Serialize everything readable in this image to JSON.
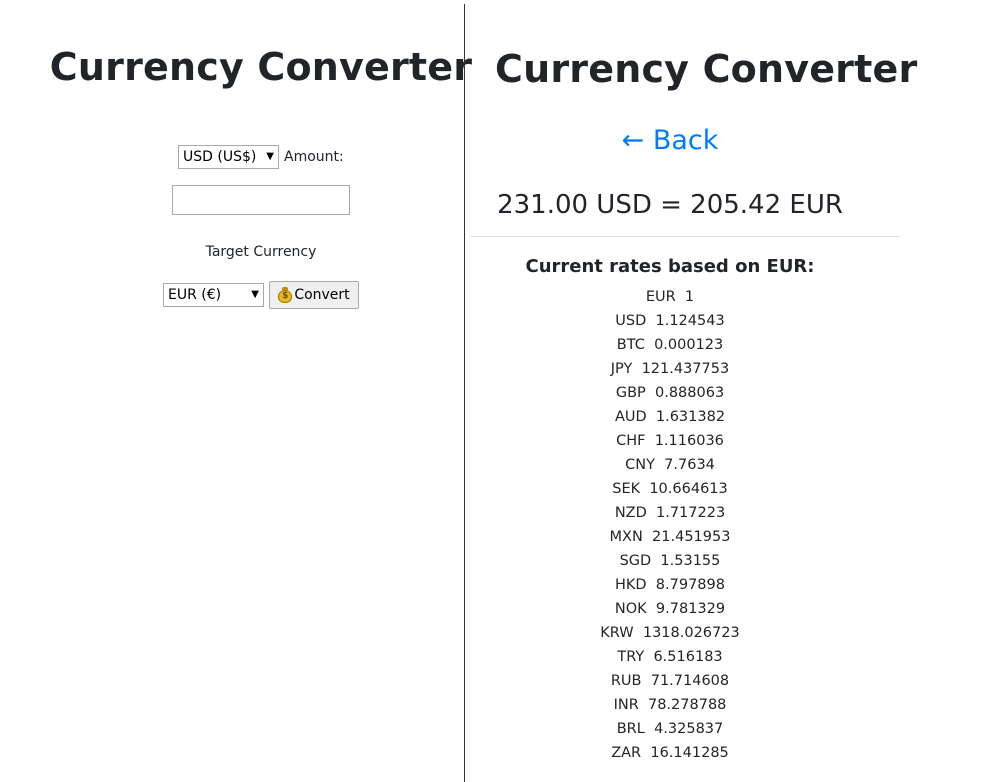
{
  "left": {
    "title": "Currency Converter",
    "source_currency": "USD (US$)",
    "amount_label": "Amount:",
    "amount_value": "",
    "target_label": "Target Currency",
    "target_currency": "EUR (€)",
    "convert_label": "Convert",
    "convert_icon": "money-bag-icon"
  },
  "right": {
    "title": "Currency Converter",
    "back_label": "← Back",
    "result": "231.00 USD = 205.42 EUR",
    "rates_title": "Current rates based on EUR:",
    "rates": [
      {
        "code": "EUR",
        "rate": "1"
      },
      {
        "code": "USD",
        "rate": "1.124543"
      },
      {
        "code": "BTC",
        "rate": "0.000123"
      },
      {
        "code": "JPY",
        "rate": "121.437753"
      },
      {
        "code": "GBP",
        "rate": "0.888063"
      },
      {
        "code": "AUD",
        "rate": "1.631382"
      },
      {
        "code": "CHF",
        "rate": "1.116036"
      },
      {
        "code": "CNY",
        "rate": "7.7634"
      },
      {
        "code": "SEK",
        "rate": "10.664613"
      },
      {
        "code": "NZD",
        "rate": "1.717223"
      },
      {
        "code": "MXN",
        "rate": "21.451953"
      },
      {
        "code": "SGD",
        "rate": "1.53155"
      },
      {
        "code": "HKD",
        "rate": "8.797898"
      },
      {
        "code": "NOK",
        "rate": "9.781329"
      },
      {
        "code": "KRW",
        "rate": "1318.026723"
      },
      {
        "code": "TRY",
        "rate": "6.516183"
      },
      {
        "code": "RUB",
        "rate": "71.714608"
      },
      {
        "code": "INR",
        "rate": "78.278788"
      },
      {
        "code": "BRL",
        "rate": "4.325837"
      },
      {
        "code": "ZAR",
        "rate": "16.141285"
      }
    ]
  },
  "colors": {
    "link": "#007bff",
    "text": "#212529",
    "divider": "#333333"
  }
}
